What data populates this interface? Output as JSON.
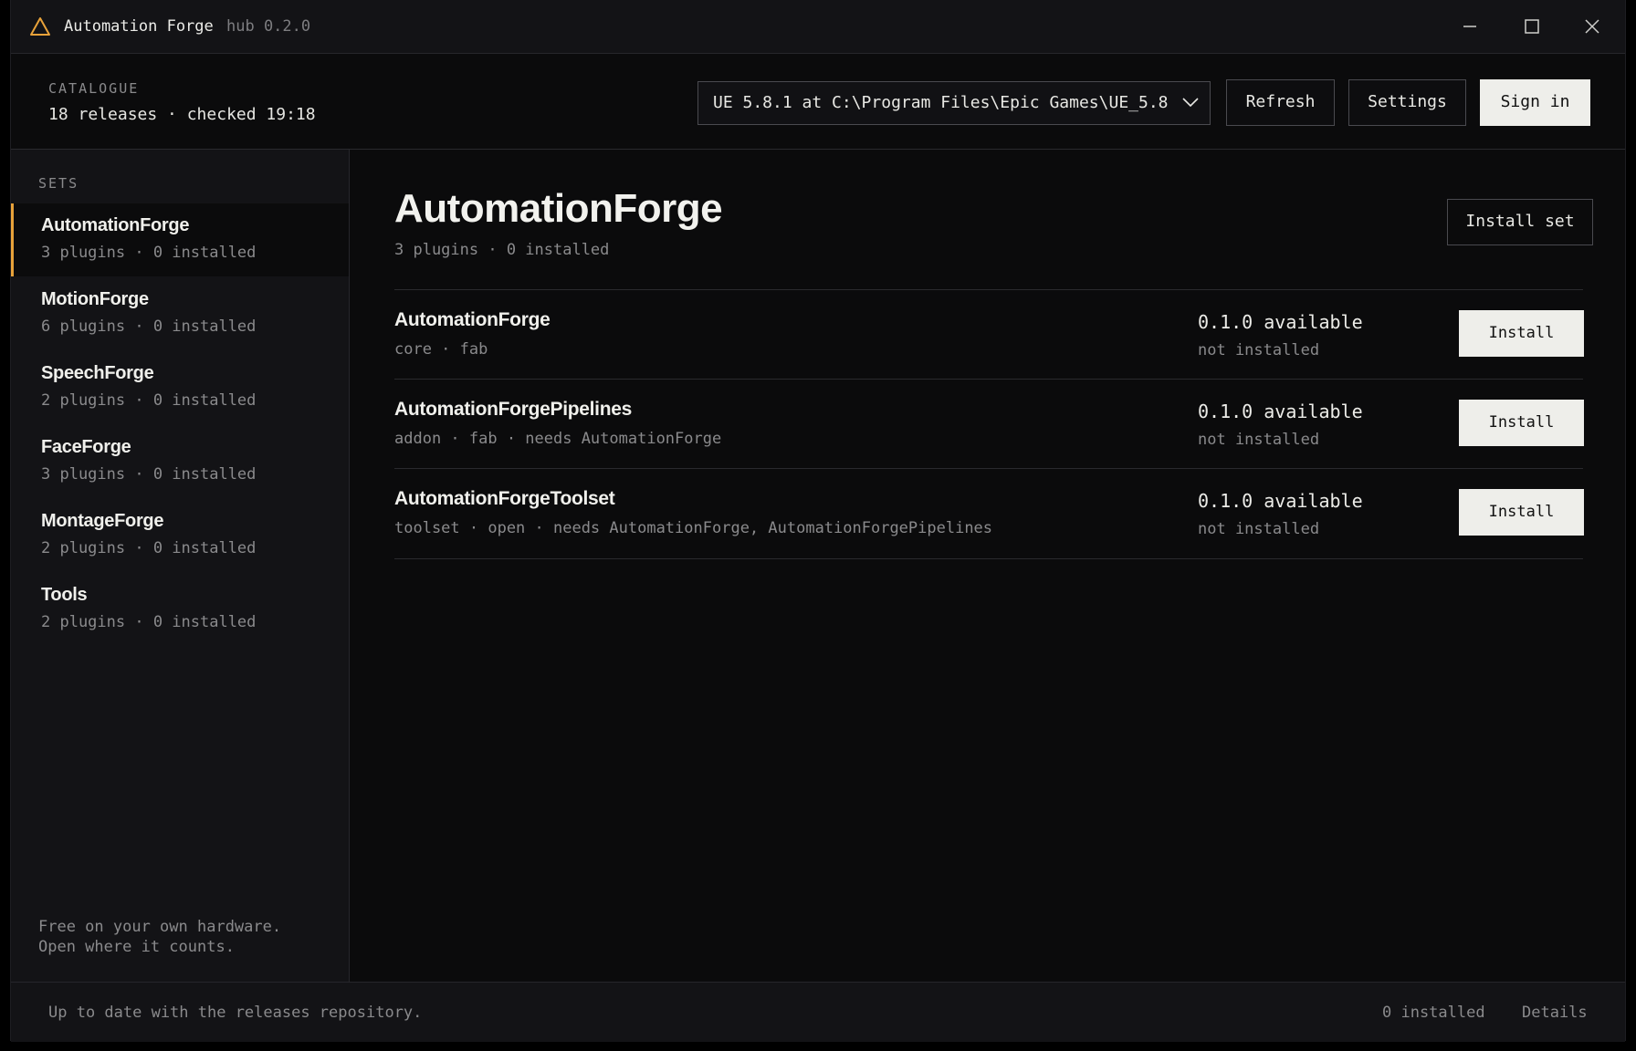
{
  "app": {
    "title": "Automation Forge",
    "version": "hub 0.2.0",
    "accent_color": "#e8a23a"
  },
  "window_controls": {
    "minimize_icon": "minimize-icon",
    "maximize_icon": "maximize-icon",
    "close_icon": "close-icon"
  },
  "header": {
    "catalogue_label": "CATALOGUE",
    "catalogue_status": "18 releases · checked 19:18",
    "engine_select_value": "UE 5.8.1 at C:\\Program Files\\Epic Games\\UE_5.8",
    "refresh_label": "Refresh",
    "settings_label": "Settings",
    "signin_label": "Sign in"
  },
  "sidebar": {
    "sets_label": "SETS",
    "items": [
      {
        "name": "AutomationForge",
        "meta": "3 plugins · 0 installed",
        "active": true
      },
      {
        "name": "MotionForge",
        "meta": "6 plugins · 0 installed"
      },
      {
        "name": "SpeechForge",
        "meta": "2 plugins · 0 installed"
      },
      {
        "name": "FaceForge",
        "meta": "3 plugins · 0 installed"
      },
      {
        "name": "MontageForge",
        "meta": "2 plugins · 0 installed"
      },
      {
        "name": "Tools",
        "meta": "2 plugins · 0 installed"
      }
    ],
    "tagline_line1": "Free on your own hardware.",
    "tagline_line2": "Open where it counts."
  },
  "main": {
    "title": "AutomationForge",
    "subtitle": "3 plugins · 0 installed",
    "install_set_label": "Install set",
    "plugins": [
      {
        "name": "AutomationForge",
        "meta": "core · fab",
        "version": "0.1.0 available",
        "status": "not installed",
        "install_label": "Install"
      },
      {
        "name": "AutomationForgePipelines",
        "meta": "addon · fab · needs AutomationForge",
        "version": "0.1.0 available",
        "status": "not installed",
        "install_label": "Install"
      },
      {
        "name": "AutomationForgeToolset",
        "meta": "toolset · open · needs AutomationForge, AutomationForgePipelines",
        "version": "0.1.0 available",
        "status": "not installed",
        "install_label": "Install"
      }
    ]
  },
  "footer": {
    "message": "Up to date with the releases repository.",
    "installed_count": "0 installed",
    "details_label": "Details"
  }
}
